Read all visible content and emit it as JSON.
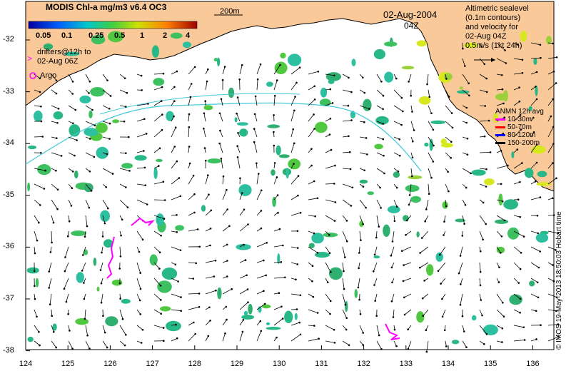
{
  "colorbar": {
    "title": "MODIS Chl-a mg/m3 v6.4 OC3",
    "ticks": [
      "0.05",
      "0.1",
      "0.25",
      "0.5",
      "1",
      "2",
      "4"
    ]
  },
  "date": "02-Aug-2004",
  "time": "04Z",
  "isobath": "200m",
  "drifters": {
    "line1": "drifters@12h to",
    "line2": "02-Aug 06Z",
    "argo": "Argo"
  },
  "altimetry": {
    "lines": [
      "Altimetric sealevel",
      "(0.1m contours)",
      "and velocity for",
      "02-Aug 04Z",
      "0.5m/s (1kt 24h)"
    ]
  },
  "anmn": {
    "title": "ANMN 12h avg",
    "items": [
      {
        "label": "10-30m",
        "color": "#ff00ff"
      },
      {
        "label": "50-70m",
        "color": "#ff0000"
      },
      {
        "label": "80-120m",
        "color": "#0000ff"
      },
      {
        "label": "150-200m",
        "color": "#000000"
      }
    ]
  },
  "credit": "© IMOS 19-May-2013 18:50:03 Hobart time",
  "axes": {
    "x_ticks": [
      "124",
      "125",
      "126",
      "127",
      "128",
      "129",
      "130",
      "131",
      "132",
      "133",
      "134",
      "135",
      "136"
    ],
    "y_ticks": [
      "-32",
      "-33",
      "-34",
      "-35",
      "-36",
      "-37",
      "-38"
    ]
  },
  "colors": {
    "land": "#f9c99a",
    "current": "#40c8d8",
    "drifter": "#ff00ff"
  }
}
